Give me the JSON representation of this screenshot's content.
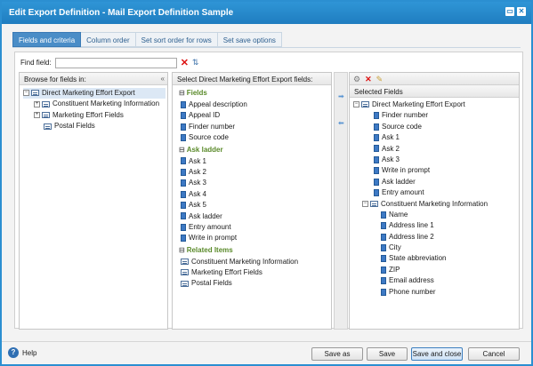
{
  "window": {
    "title": "Edit Export Definition - Mail Export Definition Sample"
  },
  "tabs": [
    "Fields and criteria",
    "Column order",
    "Set sort order for rows",
    "Set save options"
  ],
  "find": {
    "label": "Find field:",
    "value": ""
  },
  "browse": {
    "header": "Browse for fields in:",
    "items": [
      {
        "label": "Direct Marketing Effort Export",
        "expand": "⊟",
        "selected": true
      },
      {
        "label": "Constituent Marketing Information",
        "expand": "⊞"
      },
      {
        "label": "Marketing Effort Fields",
        "expand": "⊞"
      },
      {
        "label": "Postal Fields",
        "expand": ""
      }
    ]
  },
  "select": {
    "header": "Select Direct Marketing Effort Export fields:",
    "sections": [
      {
        "title": "Fields",
        "items": [
          "Appeal description",
          "Appeal ID",
          "Finder number",
          "Source code"
        ]
      },
      {
        "title": "Ask ladder",
        "items": [
          "Ask 1",
          "Ask 2",
          "Ask 3",
          "Ask 4",
          "Ask 5",
          "Ask ladder",
          "Entry amount",
          "Write in prompt"
        ]
      },
      {
        "title": "Related Items",
        "items": [
          "Constituent Marketing Information",
          "Marketing Effort Fields",
          "Postal Fields"
        ]
      }
    ]
  },
  "selected": {
    "header": "Selected Fields",
    "root": "Direct Marketing Effort Export",
    "root_items": [
      "Finder number",
      "Source code",
      "Ask 1",
      "Ask 2",
      "Ask 3",
      "Write in prompt",
      "Ask ladder",
      "Entry amount"
    ],
    "group": "Constituent Marketing Information",
    "group_items": [
      "Name",
      "Address line 1",
      "Address line 2",
      "City",
      "State abbreviation",
      "ZIP",
      "Email address",
      "Phone number"
    ]
  },
  "footer": {
    "help": "Help",
    "save_as": "Save as",
    "save": "Save",
    "save_close": "Save and close",
    "cancel": "Cancel"
  },
  "icons": {
    "collapse_all": "«",
    "move_right": "➡",
    "move_left": "⬅",
    "clear": "✕",
    "tree": "⇅",
    "minimize": "▭",
    "close": "✕"
  }
}
